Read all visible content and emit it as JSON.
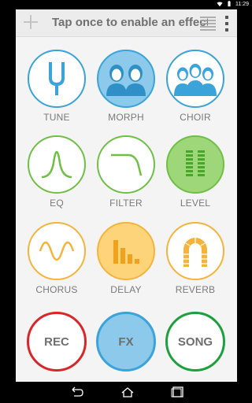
{
  "status": {
    "time": "11:29"
  },
  "header": {
    "title": "Tap once to enable an effect"
  },
  "colors": {
    "blue": "#3aa3d9",
    "blue_fill": "#8cc9ea",
    "green": "#6fbf45",
    "green_fill": "#9ed77a",
    "orange": "#f5b33b",
    "orange_fill": "#fdd47a",
    "red": "#d9262a",
    "fx_fill": "#8cc9ea",
    "song_green": "#1e9f3e"
  },
  "effects": {
    "tune": "TUNE",
    "morph": "MORPH",
    "choir": "CHOIR",
    "eq": "EQ",
    "filter": "FILTER",
    "level": "LEVEL",
    "chorus": "CHORUS",
    "delay": "DELAY",
    "reverb": "REVERB"
  },
  "buttons": {
    "rec": "REC",
    "fx": "FX",
    "song": "SONG"
  }
}
